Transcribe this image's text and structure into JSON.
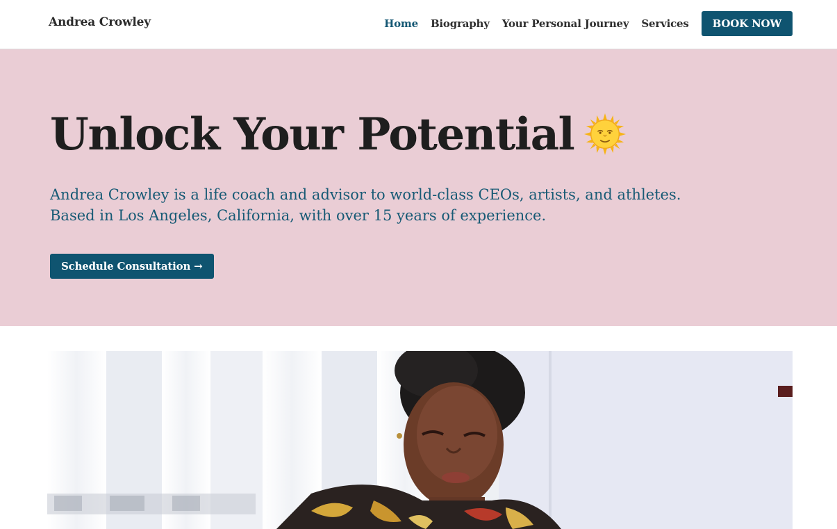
{
  "header": {
    "brand": "Andrea Crowley",
    "nav": [
      {
        "label": "Home",
        "active": true
      },
      {
        "label": "Biography"
      },
      {
        "label": "Your Personal Journey"
      },
      {
        "label": "Services"
      }
    ],
    "book_label": "BOOK NOW"
  },
  "hero": {
    "title": "Unlock Your Potential",
    "title_icon": "sun-with-face-emoji",
    "subtitle_line1": "Andrea Crowley is a life coach and advisor to world-class CEOs, artists, and athletes.",
    "subtitle_line2": "Based in Los Angeles, California, with over 15 years of experience.",
    "cta_label": "Schedule Consultation →"
  },
  "colors": {
    "hero_bg": "#eacdd5",
    "accent": "#0f5470",
    "subtitle": "#175a75"
  },
  "photo": {
    "icon": "woman-portrait-image"
  }
}
